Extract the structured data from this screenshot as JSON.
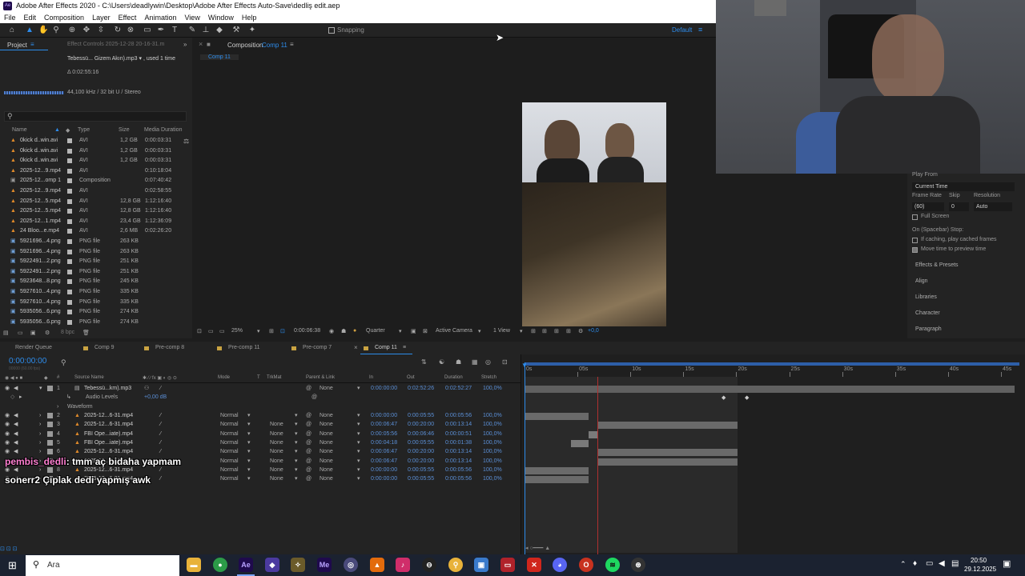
{
  "window": {
    "title": "Adobe After Effects 2020 - C:\\Users\\deadlywin\\Desktop\\Adobe After Effects Auto-Save\\dedliş edit.aep",
    "logo": "Ae"
  },
  "menu": [
    "File",
    "Edit",
    "Composition",
    "Layer",
    "Effect",
    "Animation",
    "View",
    "Window",
    "Help"
  ],
  "toolbar": {
    "snapping": "Snapping",
    "workspace": "Default"
  },
  "project": {
    "tab": "Project",
    "effect_controls": "Effect Controls 2025-12-28 20-16-31.m",
    "selected_name": "Tebessü... Gizem Akın).mp3 ▾ , used 1 time",
    "duration": "Δ 0:02:55:16",
    "audio_info": "44,100 kHz / 32 bit U / Stereo",
    "search_placeholder": "",
    "columns": {
      "name": "Name",
      "type": "Type",
      "size": "Size",
      "duration": "Media Duration"
    },
    "items": [
      {
        "name": "0kick d..win.avi",
        "type": "AVI",
        "size": "1,2 GB",
        "duration": "0:00:03:31"
      },
      {
        "name": "0kick d..win.avi",
        "type": "AVI",
        "size": "1,2 GB",
        "duration": "0:00:03:31"
      },
      {
        "name": "0kick d..win.avi",
        "type": "AVI",
        "size": "1,2 GB",
        "duration": "0:00:03:31"
      },
      {
        "name": "2025-12...9.mp4",
        "type": "AVI",
        "size": "",
        "duration": "0:10:18:04"
      },
      {
        "name": "2025-12...omp 1",
        "type": "Composition",
        "size": "",
        "duration": "0:07:40:42"
      },
      {
        "name": "2025-12...9.mp4",
        "type": "AVI",
        "size": "",
        "duration": "0:02:58:55"
      },
      {
        "name": "2025-12...5.mp4",
        "type": "AVI",
        "size": "12,8 GB",
        "duration": "1:12:16:40"
      },
      {
        "name": "2025-12...5.mp4",
        "type": "AVI",
        "size": "12,8 GB",
        "duration": "1:12:16:40"
      },
      {
        "name": "2025-12...1.mp4",
        "type": "AVI",
        "size": "23,4 GB",
        "duration": "1:12:36:09"
      },
      {
        "name": "24 Bloo...e.mp4",
        "type": "AVI",
        "size": "2,6 MB",
        "duration": "0:02:26:20"
      },
      {
        "name": "5921696...4.png",
        "type": "PNG file",
        "size": "263 KB",
        "duration": ""
      },
      {
        "name": "5921696...4.png",
        "type": "PNG file",
        "size": "263 KB",
        "duration": ""
      },
      {
        "name": "5922491...2.png",
        "type": "PNG file",
        "size": "251 KB",
        "duration": ""
      },
      {
        "name": "5922491...2.png",
        "type": "PNG file",
        "size": "251 KB",
        "duration": ""
      },
      {
        "name": "5923648...8.png",
        "type": "PNG file",
        "size": "245 KB",
        "duration": ""
      },
      {
        "name": "5927610...4.png",
        "type": "PNG file",
        "size": "335 KB",
        "duration": ""
      },
      {
        "name": "5927610...4.png",
        "type": "PNG file",
        "size": "335 KB",
        "duration": ""
      },
      {
        "name": "5935056...6.png",
        "type": "PNG file",
        "size": "274 KB",
        "duration": ""
      },
      {
        "name": "5935056...6.png",
        "type": "PNG file",
        "size": "274 KB",
        "duration": ""
      }
    ],
    "bpc": "8 bpc"
  },
  "composition": {
    "tab_prefix": "Composition",
    "tab_name": "Comp 11",
    "sub_tab": "Comp 11",
    "zoom": "25%",
    "time": "0:00:06:38",
    "resolution": "Quarter",
    "camera": "Active Camera",
    "views": "1 View",
    "exposure": "+0,0"
  },
  "preview": {
    "play_from": "Play From",
    "play_from_value": "Current Time",
    "frame_rate": "Frame Rate",
    "skip": "Skip",
    "resolution": "Resolution",
    "frame_rate_value": "(60)",
    "skip_value": "0",
    "resolution_value": "Auto",
    "full_screen": "Full Screen",
    "on_stop": "On (Spacebar) Stop:",
    "if_caching": "If caching, play cached frames",
    "move_time": "Move time to preview time",
    "panels": [
      "Effects & Presets",
      "Align",
      "Libraries",
      "Character",
      "Paragraph"
    ]
  },
  "timeline": {
    "tabs": [
      "Render Queue",
      "Comp 9",
      "Pre-comp 8",
      "Pre-comp 11",
      "Pre-comp 7",
      "Comp 11"
    ],
    "timecode": "0:00:00:00",
    "fps": "00000 (60.00 fps)",
    "ruler": [
      "0s",
      "05s",
      "10s",
      "15s",
      "20s",
      "25s",
      "30s",
      "35s",
      "40s",
      "45s"
    ],
    "columns": {
      "source": "Source Name",
      "mode": "Mode",
      "t": "T",
      "trkmat": "TrkMat",
      "parent": "Parent & Link",
      "in": "In",
      "out": "Out",
      "duration": "Duration",
      "stretch": "Stretch"
    },
    "audio_row": {
      "num": "1",
      "name": "Tebessü...km).mp3",
      "parent": "None",
      "in": "0:00:00:00",
      "out": "0:02:52:26",
      "duration": "0:02:52:27",
      "stretch": "100,0%"
    },
    "audio_levels": "Audio Levels",
    "audio_levels_value": "+0,00 dB",
    "waveform": "Waveform",
    "layers": [
      {
        "num": "2",
        "name": "2025-12...6-31.mp4",
        "mode": "Normal",
        "trkmat": "",
        "parent": "None",
        "in": "0:00:00:00",
        "out": "0:00:05:55",
        "duration": "0:00:05:56",
        "stretch": "100,0%"
      },
      {
        "num": "3",
        "name": "2025-12...6-31.mp4",
        "mode": "Normal",
        "trkmat": "None",
        "parent": "None",
        "in": "0:00:06:47",
        "out": "0:00:20:00",
        "duration": "0:00:13:14",
        "stretch": "100,0%"
      },
      {
        "num": "4",
        "name": "FBI Ope...iate).mp4",
        "mode": "Normal",
        "trkmat": "None",
        "parent": "None",
        "in": "0:00:05:56",
        "out": "0:00:06:46",
        "duration": "0:00:00:51",
        "stretch": "100,0%"
      },
      {
        "num": "5",
        "name": "FBI Ope...iate).mp4",
        "mode": "Normal",
        "trkmat": "None",
        "parent": "None",
        "in": "0:00:04:18",
        "out": "0:00:05:55",
        "duration": "0:00:01:38",
        "stretch": "100,0%"
      },
      {
        "num": "6",
        "name": "2025-12...6-31.mp4",
        "mode": "Normal",
        "trkmat": "None",
        "parent": "None",
        "in": "0:00:06:47",
        "out": "0:00:20:00",
        "duration": "0:00:13:14",
        "stretch": "100,0%"
      },
      {
        "num": "7",
        "name": "2025-12...6-31.mp4",
        "mode": "Normal",
        "trkmat": "None",
        "parent": "None",
        "in": "0:00:06:47",
        "out": "0:00:20:00",
        "duration": "0:00:13:14",
        "stretch": "100,0%"
      },
      {
        "num": "8",
        "name": "2025-12...6-31.mp4",
        "mode": "Normal",
        "trkmat": "None",
        "parent": "None",
        "in": "0:00:00:00",
        "out": "0:00:05:55",
        "duration": "0:00:05:56",
        "stretch": "100,0%"
      },
      {
        "num": "9",
        "name": "2025-12...6-31.mp4",
        "mode": "Normal",
        "trkmat": "None",
        "parent": "None",
        "in": "0:00:00:00",
        "out": "0:00:05:55",
        "duration": "0:00:05:56",
        "stretch": "100,0%"
      }
    ]
  },
  "chat": [
    {
      "user": "pembis_dedli",
      "text": ": tmm aç bidaha yapmam"
    },
    {
      "user": "sonerr2",
      "text": " Çıplak dedi yapmış awk"
    }
  ],
  "taskbar": {
    "search_placeholder": "Ara",
    "time": "20:50",
    "date": "29.12.2025"
  },
  "colors": {
    "accent": "#2d8ceb",
    "playhead": "#b03030",
    "user1": "#ff7fd1",
    "user2": "#ffffff"
  }
}
